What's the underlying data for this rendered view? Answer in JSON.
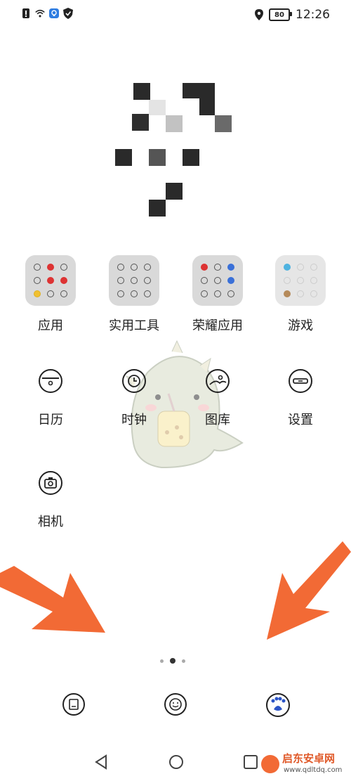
{
  "status_bar": {
    "battery": "80",
    "time": "12:26"
  },
  "apps": [
    {
      "label": "应用"
    },
    {
      "label": "实用工具"
    },
    {
      "label": "荣耀应用"
    },
    {
      "label": "游戏"
    },
    {
      "label": "日历"
    },
    {
      "label": "时钟"
    },
    {
      "label": "图库"
    },
    {
      "label": "设置"
    },
    {
      "label": "相机"
    }
  ],
  "page_indicator": {
    "pages": 3,
    "active": 2
  },
  "watermark": {
    "brand": "启东安卓网",
    "url": "www.qdltdq.com"
  },
  "colors": {
    "arrow": "#f26a35",
    "folder_bg": "#d9d9d9"
  }
}
